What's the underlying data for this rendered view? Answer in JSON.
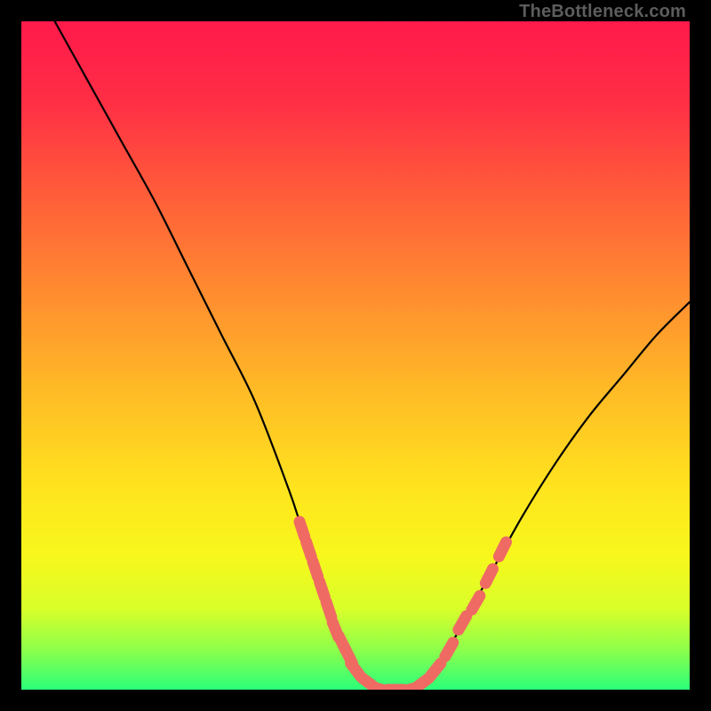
{
  "watermark": "TheBottleneck.com",
  "colors": {
    "background": "#000000",
    "gradient_stops": [
      {
        "offset": 0.0,
        "color": "#ff1a4b"
      },
      {
        "offset": 0.12,
        "color": "#ff2e45"
      },
      {
        "offset": 0.25,
        "color": "#ff5a3a"
      },
      {
        "offset": 0.4,
        "color": "#ff8a30"
      },
      {
        "offset": 0.55,
        "color": "#ffba26"
      },
      {
        "offset": 0.7,
        "color": "#ffe41e"
      },
      {
        "offset": 0.8,
        "color": "#f7f71c"
      },
      {
        "offset": 0.88,
        "color": "#d8ff2a"
      },
      {
        "offset": 0.94,
        "color": "#8dff4a"
      },
      {
        "offset": 1.0,
        "color": "#2bff7a"
      }
    ],
    "curve": "#000000",
    "marker": "#ef6a63"
  },
  "chart_data": {
    "type": "line",
    "title": "",
    "xlabel": "",
    "ylabel": "",
    "xlim": [
      0,
      100
    ],
    "ylim": [
      0,
      100
    ],
    "series": [
      {
        "name": "bottleneck-curve",
        "x": [
          5,
          10,
          15,
          20,
          25,
          30,
          35,
          40,
          42,
          45,
          48,
          50,
          52,
          55,
          58,
          60,
          62,
          65,
          70,
          75,
          80,
          85,
          90,
          95,
          100
        ],
        "y": [
          100,
          91,
          82,
          73,
          63,
          53,
          43,
          30,
          24,
          15,
          7,
          3,
          1,
          0,
          0,
          1,
          3,
          8,
          17,
          26,
          34,
          41,
          47,
          53,
          58
        ]
      }
    ],
    "markers": {
      "name": "highlight-points",
      "x": [
        42,
        43,
        44,
        45,
        46,
        47,
        48,
        49,
        50,
        52,
        54,
        56,
        58,
        60,
        62,
        64,
        66,
        68,
        70,
        72
      ],
      "y": [
        24,
        21,
        18,
        15,
        12,
        9,
        7,
        5,
        3,
        1,
        0,
        0,
        0,
        1,
        3,
        6,
        10,
        13,
        17,
        21
      ]
    }
  }
}
